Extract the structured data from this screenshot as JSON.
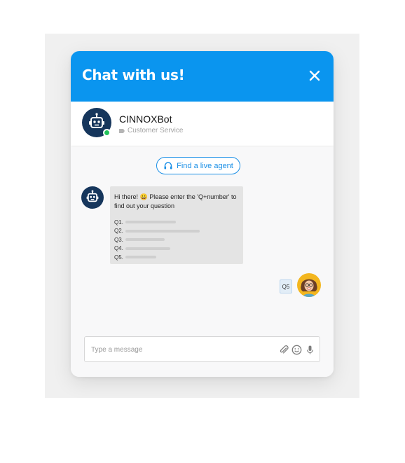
{
  "header": {
    "title": "Chat with us!",
    "close_icon": "close-icon"
  },
  "agent": {
    "name": "CINNOXBot",
    "role": "Customer Service",
    "status": "online"
  },
  "live_agent_button": {
    "label": "Find a live agent",
    "icon": "headset-icon"
  },
  "bot_message": {
    "greeting": "Hi there! 😀 Please enter the 'Q+number' to find out your question",
    "questions": [
      "Q1.",
      "Q2.",
      "Q3.",
      "Q4.",
      "Q5."
    ]
  },
  "user_message": {
    "text": "Q5"
  },
  "composer": {
    "placeholder": "Type a message",
    "icons": [
      "attachment-icon",
      "emoji-icon",
      "microphone-icon"
    ]
  },
  "colors": {
    "brand": "#0a95ef",
    "avatar_bg": "#16365c",
    "online": "#22c25a"
  }
}
